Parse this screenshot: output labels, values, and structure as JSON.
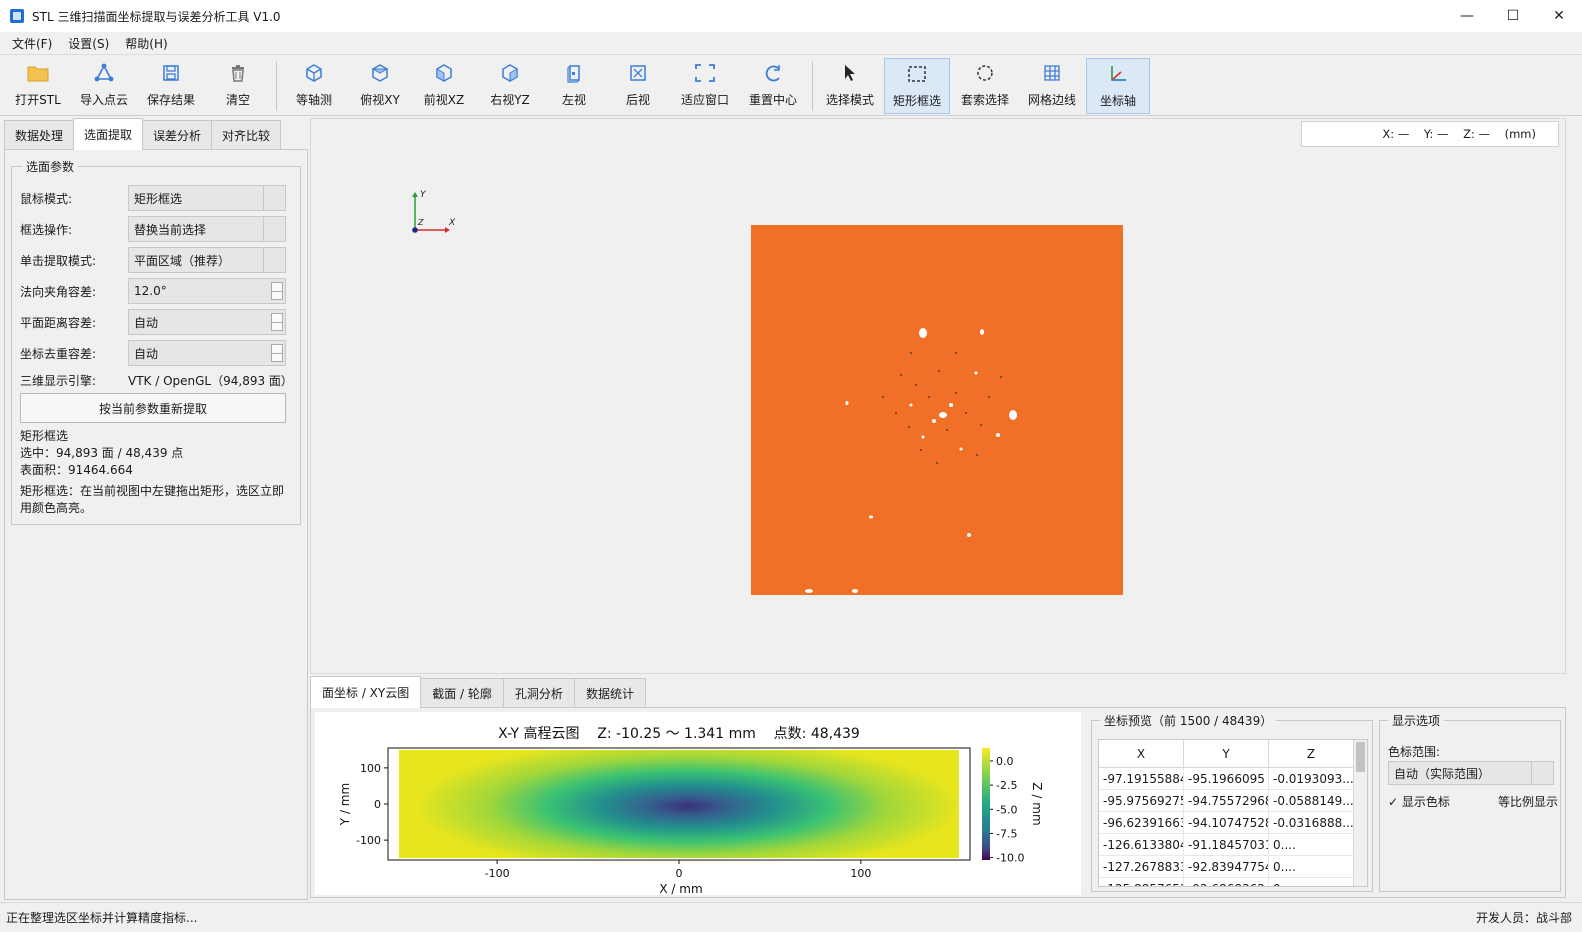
{
  "window": {
    "title": "STL 三维扫描面坐标提取与误差分析工具 V1.0",
    "minimize": "—",
    "maximize": "☐",
    "close": "✕"
  },
  "menu": [
    "文件(F)",
    "设置(S)",
    "帮助(H)"
  ],
  "toolbar": {
    "buttons": [
      {
        "label": "打开STL",
        "icon": "folder-icon"
      },
      {
        "label": "导入点云",
        "icon": "point-cloud-icon"
      },
      {
        "label": "保存结果",
        "icon": "save-icon"
      },
      {
        "label": "清空",
        "icon": "trash-icon"
      },
      {
        "label": "等轴测",
        "icon": "cube-iso-icon"
      },
      {
        "label": "俯视XY",
        "icon": "cube-top-icon"
      },
      {
        "label": "前视XZ",
        "icon": "cube-front-icon"
      },
      {
        "label": "右视YZ",
        "icon": "cube-right-icon"
      },
      {
        "label": "左视",
        "icon": "view-left-icon"
      },
      {
        "label": "后视",
        "icon": "view-back-icon"
      },
      {
        "label": "适应窗口",
        "icon": "fit-window-icon"
      },
      {
        "label": "重置中心",
        "icon": "reset-center-icon"
      },
      {
        "label": "选择模式",
        "icon": "pointer-icon"
      },
      {
        "label": "矩形框选",
        "icon": "rect-select-icon",
        "active": true
      },
      {
        "label": "套索选择",
        "icon": "lasso-icon"
      },
      {
        "label": "网格边线",
        "icon": "grid-edges-icon"
      },
      {
        "label": "坐标轴",
        "icon": "axes-icon",
        "active": true
      }
    ]
  },
  "left": {
    "tabs": [
      "数据处理",
      "选面提取",
      "误差分析",
      "对齐比较"
    ],
    "active_tab": 1,
    "group_title": "选面参数",
    "params": [
      {
        "label": "鼠标模式:",
        "value": "矩形框选",
        "kind": "combo"
      },
      {
        "label": "框选操作:",
        "value": "替换当前选择",
        "kind": "combo"
      },
      {
        "label": "单击提取模式:",
        "value": "平面区域（推荐）",
        "kind": "combo"
      },
      {
        "label": "法向夹角容差:",
        "value": "12.0°",
        "kind": "spin"
      },
      {
        "label": "平面距离容差:",
        "value": "自动",
        "kind": "spin"
      },
      {
        "label": "坐标去重容差:",
        "value": "自动",
        "kind": "spin"
      }
    ],
    "engine_label": "三维显示引擎:",
    "engine_value": "VTK / OpenGL（94,893 面）",
    "reextract_button": "按当前参数重新提取",
    "info_lines": [
      "矩形框选",
      "选中：94,893 面 / 48,439 点",
      "表面积：91464.664"
    ],
    "tip": "矩形框选：在当前视图中左键拖出矩形，选区立即用颜色高亮。"
  },
  "viewport": {
    "coord_readout": "X: —    Y: —    Z: —    (mm)",
    "axis_labels": {
      "y": "Y",
      "z": "Z",
      "x": "X"
    },
    "mesh_color": "#f07028"
  },
  "bottom": {
    "tabs": [
      "面坐标 / XY云图",
      "截面 / 轮廓",
      "孔洞分析",
      "数据统计"
    ],
    "active_tab": 0,
    "plot": {
      "title": "X-Y 高程云图    Z: -10.25 ～ 1.341 mm    点数: 48,439",
      "xlabel": "X / mm",
      "ylabel": "Y / mm",
      "colorbar_label": "Z / mm",
      "xticks": [
        "-100",
        "0",
        "100"
      ],
      "yticks": [
        "100",
        "0",
        "-100"
      ],
      "cticks": [
        "0.0",
        "-2.5",
        "-5.0",
        "-7.5",
        "-10.0"
      ]
    },
    "preview": {
      "title": "坐标预览（前 1500 / 48439）",
      "columns": [
        "X",
        "Y",
        "Z"
      ],
      "rows": [
        [
          "-97.19155884",
          "-95.1966095",
          "-0.0193093..."
        ],
        [
          "-95.97569275",
          "-94.75572968",
          "-0.0588149..."
        ],
        [
          "-96.62391663",
          "-94.10747528",
          "-0.0316888..."
        ],
        [
          "-126.6133804",
          "-91.18457031",
          "0...."
        ],
        [
          "-127.2678833",
          "-92.83947754",
          "0...."
        ],
        [
          "-125.8857651",
          "-92.68683624",
          "0..."
        ]
      ]
    },
    "display": {
      "title": "显示选项",
      "color_range_label": "色标范围:",
      "color_range_value": "自动（实际范围）",
      "show_colorbar": "显示色标",
      "equal_scale": "等比例显示"
    }
  },
  "status": {
    "left": "正在整理选区坐标并计算精度指标...",
    "right": "开发人员：战斗部"
  },
  "chart_data": {
    "type": "heatmap",
    "title": "X-Y 高程云图",
    "xlabel": "X / mm",
    "ylabel": "Y / mm",
    "colorbar_label": "Z / mm",
    "z_range": [
      -10.25,
      1.341
    ],
    "point_count": 48439,
    "xlim": [
      -160,
      160
    ],
    "ylim": [
      -155,
      155
    ],
    "colorbar_ticks": [
      0.0,
      -2.5,
      -5.0,
      -7.5,
      -10.0
    ],
    "colormap": "viridis"
  }
}
